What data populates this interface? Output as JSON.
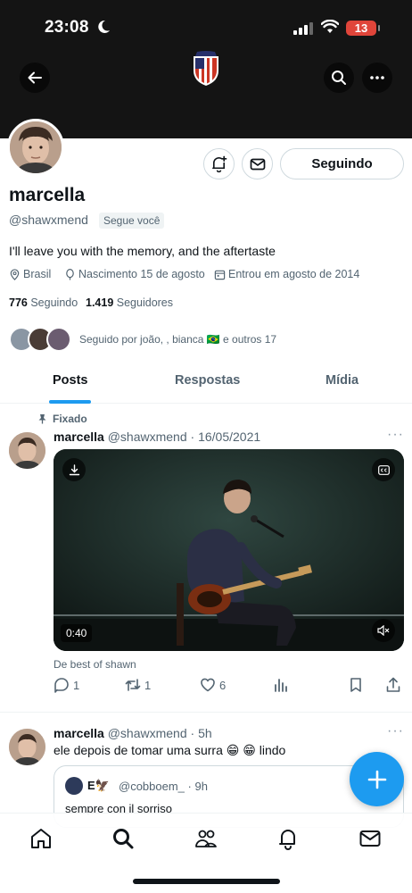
{
  "status_bar": {
    "time": "23:08",
    "battery": "13"
  },
  "profile": {
    "name": "marcella",
    "handle": "@shawxmend",
    "follows_you": "Segue você",
    "bio": "I'll leave you with the memory, and the aftertaste",
    "location": "Brasil",
    "birth": "Nascimento 15 de agosto",
    "joined": "Entrou em agosto de 2014",
    "following_count": "776",
    "following_label": "Seguindo",
    "followers_count": "1.419",
    "followers_label": "Seguidores",
    "followed_by": "Seguido por joão, , bianca 🇧🇷 e outros 17",
    "follow_button": "Seguindo"
  },
  "tabs": [
    {
      "label": "Posts",
      "active": true
    },
    {
      "label": "Respostas",
      "active": false
    },
    {
      "label": "Mídia",
      "active": false
    }
  ],
  "posts": [
    {
      "pinned_label": "Fixado",
      "name": "marcella",
      "handle": "@shawxmend",
      "time": "· 16/05/2021",
      "video_duration": "0:40",
      "caption": "De best of shawn",
      "replies": "1",
      "retweets": "1",
      "likes": "6"
    },
    {
      "name": "marcella",
      "handle": "@shawxmend",
      "time": "· 5h",
      "text": "ele depois de tomar uma surra 😁 😁 lindo",
      "quote": {
        "name": "E🦅",
        "handle": "@cobboem_ · 9h",
        "text": "sempre con il sorriso"
      }
    }
  ],
  "colors": {
    "accent": "#1d9bf0",
    "banner": "#141414",
    "secondary_text": "#536471"
  }
}
